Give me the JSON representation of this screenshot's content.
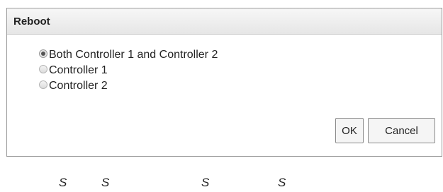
{
  "dialog": {
    "title": "Reboot",
    "options": [
      {
        "label": "Both Controller 1 and Controller 2",
        "selected": true
      },
      {
        "label": "Controller 1",
        "selected": false
      },
      {
        "label": "Controller 2",
        "selected": false
      }
    ],
    "ok_label": "OK",
    "cancel_label": "Cancel"
  },
  "footer": {
    "marks": [
      "S",
      "S",
      "S",
      "S"
    ]
  }
}
